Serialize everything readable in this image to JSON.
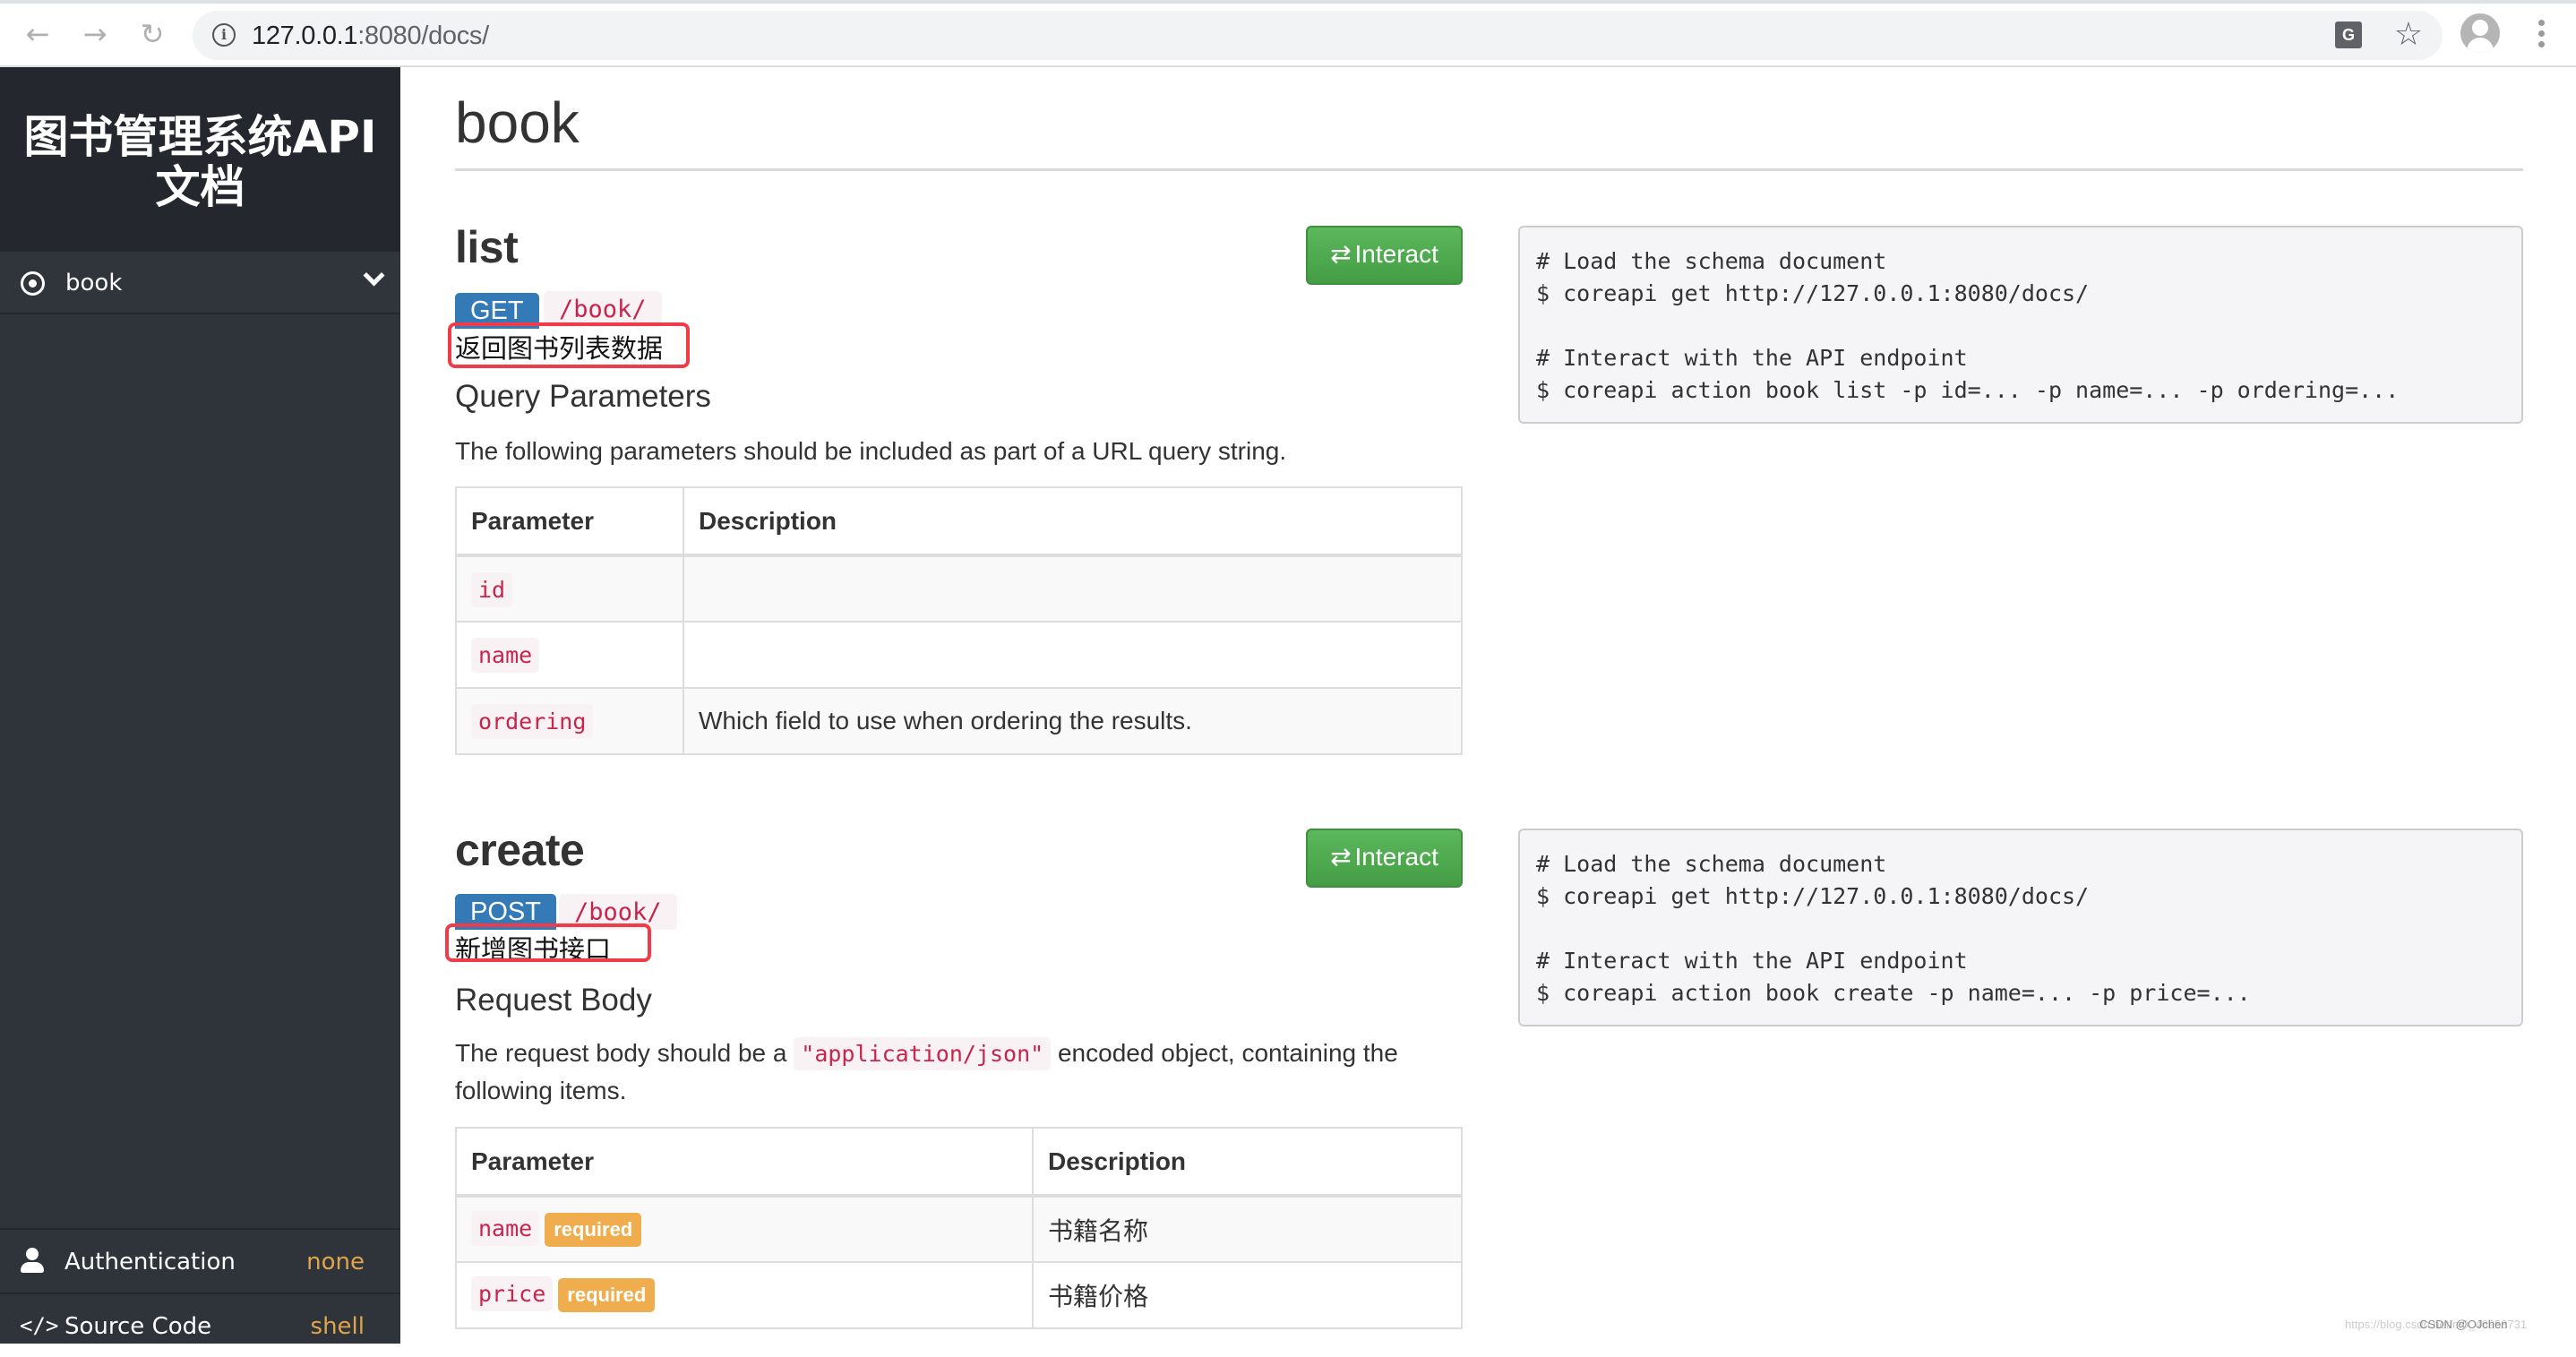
{
  "browser": {
    "url_host": "127.0.0.1",
    "url_rest": ":8080/docs/",
    "back_icon": "arrow-left-icon",
    "forward_icon": "arrow-right-icon",
    "reload_icon": "reload-icon"
  },
  "sidebar": {
    "brand": "图书管理系统API文档",
    "items": [
      {
        "label": "book",
        "icon": "radio-dot-icon",
        "expanded": true
      }
    ],
    "bottom": [
      {
        "label": "Authentication",
        "value": "none",
        "icon": "user-icon"
      },
      {
        "label": "Source Code",
        "value": "shell",
        "icon": "code-icon"
      }
    ],
    "accent_color": "#e0a44c"
  },
  "main": {
    "title": "book",
    "endpoints": [
      {
        "name": "list",
        "method": "GET",
        "path": "/book/",
        "description": "返回图书列表数据",
        "interact_label": "Interact",
        "section_title": "Query Parameters",
        "section_text": "The following parameters should be included as part of a URL query string.",
        "table": {
          "headers": [
            "Parameter",
            "Description"
          ],
          "rows": [
            {
              "param": "id",
              "required": false,
              "description": ""
            },
            {
              "param": "name",
              "required": false,
              "description": ""
            },
            {
              "param": "ordering",
              "required": false,
              "description": "Which field to use when ordering the results."
            }
          ]
        },
        "code": [
          "# Load the schema document",
          "$ coreapi get http://127.0.0.1:8080/docs/",
          "",
          "# Interact with the API endpoint",
          "$ coreapi action book list -p id=... -p name=... -p ordering=..."
        ]
      },
      {
        "name": "create",
        "method": "POST",
        "path": "/book/",
        "description": "新增图书接口",
        "interact_label": "Interact",
        "section_title": "Request Body",
        "section_text_before": "The request body should be a ",
        "section_text_code": "\"application/json\"",
        "section_text_after": " encoded object, containing the following items.",
        "table": {
          "headers": [
            "Parameter",
            "Description"
          ],
          "rows": [
            {
              "param": "name",
              "required": true,
              "required_label": "required",
              "description": "书籍名称"
            },
            {
              "param": "price",
              "required": true,
              "required_label": "required",
              "description": "书籍价格"
            }
          ]
        },
        "code": [
          "# Load the schema document",
          "$ coreapi get http://127.0.0.1:8080/docs/",
          "",
          "# Interact with the API endpoint",
          "$ coreapi action book create -p name=... -p price=..."
        ]
      }
    ]
  },
  "watermark": {
    "url": "https://blog.csdn.net/m0_46958731",
    "author": "CSDN @OJchen"
  },
  "colors": {
    "method_badge": "#337ab7",
    "interact_button": "#5cb85c",
    "code_text": "#c7254e",
    "required_badge": "#f0ad4e",
    "annotation_box": "#f03b4a"
  }
}
